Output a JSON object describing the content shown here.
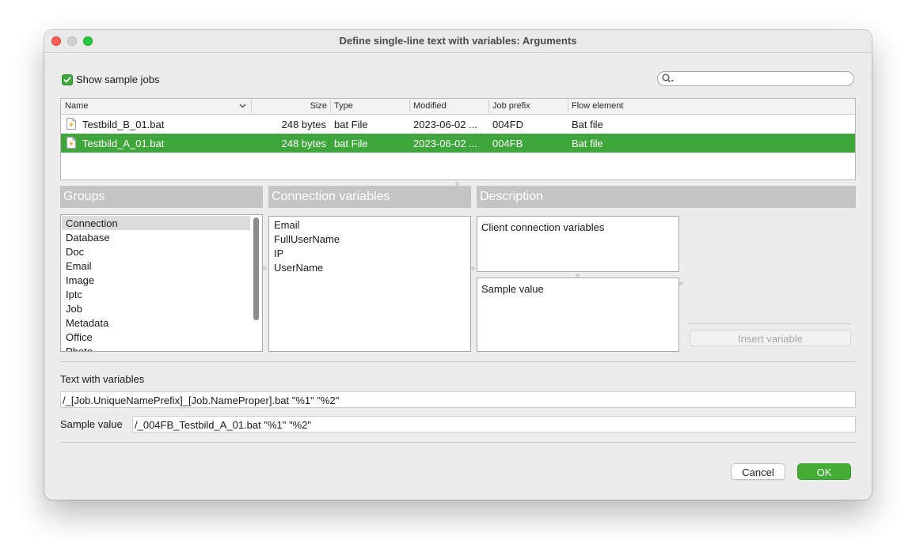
{
  "window": {
    "title": "Define single-line text with variables: Arguments"
  },
  "show_sample_jobs": {
    "label": "Show sample jobs",
    "checked": true
  },
  "search": {
    "value": ""
  },
  "jobs_table": {
    "columns": [
      "Name",
      "Size",
      "Type",
      "Modified",
      "Job prefix",
      "Flow element"
    ],
    "rows": [
      {
        "name": "Testbild_B_01.bat",
        "size": "248 bytes",
        "type": "bat File",
        "modified": "2023-06-02 ...",
        "job_prefix": "004FD",
        "flow_element": "Bat file",
        "selected": false
      },
      {
        "name": "Testbild_A_01.bat",
        "size": "248 bytes",
        "type": "bat File",
        "modified": "2023-06-02 ...",
        "job_prefix": "004FB",
        "flow_element": "Bat file",
        "selected": true
      }
    ]
  },
  "groups": {
    "header": "Groups",
    "items": [
      "Connection",
      "Database",
      "Doc",
      "Email",
      "Image",
      "Iptc",
      "Job",
      "Metadata",
      "Office",
      "Photo"
    ],
    "selected": "Connection"
  },
  "variables": {
    "header": "Connection variables",
    "items": [
      "Email",
      "FullUserName",
      "IP",
      "UserName"
    ]
  },
  "description": {
    "header": "Description",
    "text": "Client connection variables",
    "sample_value_label": "Sample value"
  },
  "insert_variable": {
    "label": "Insert variable",
    "enabled": false
  },
  "text_with_variables": {
    "label": "Text with variables",
    "value": "/_[Job.UniqueNamePrefix]_[Job.NameProper].bat \"%1\" \"%2\""
  },
  "sample_value": {
    "label": "Sample value",
    "value": "/_004FB_Testbild_A_01.bat \"%1\" \"%2\""
  },
  "footer": {
    "cancel": "Cancel",
    "ok": "OK"
  },
  "colors": {
    "accent_green": "#3ea63a",
    "header_gray": "#c4c4c4"
  }
}
